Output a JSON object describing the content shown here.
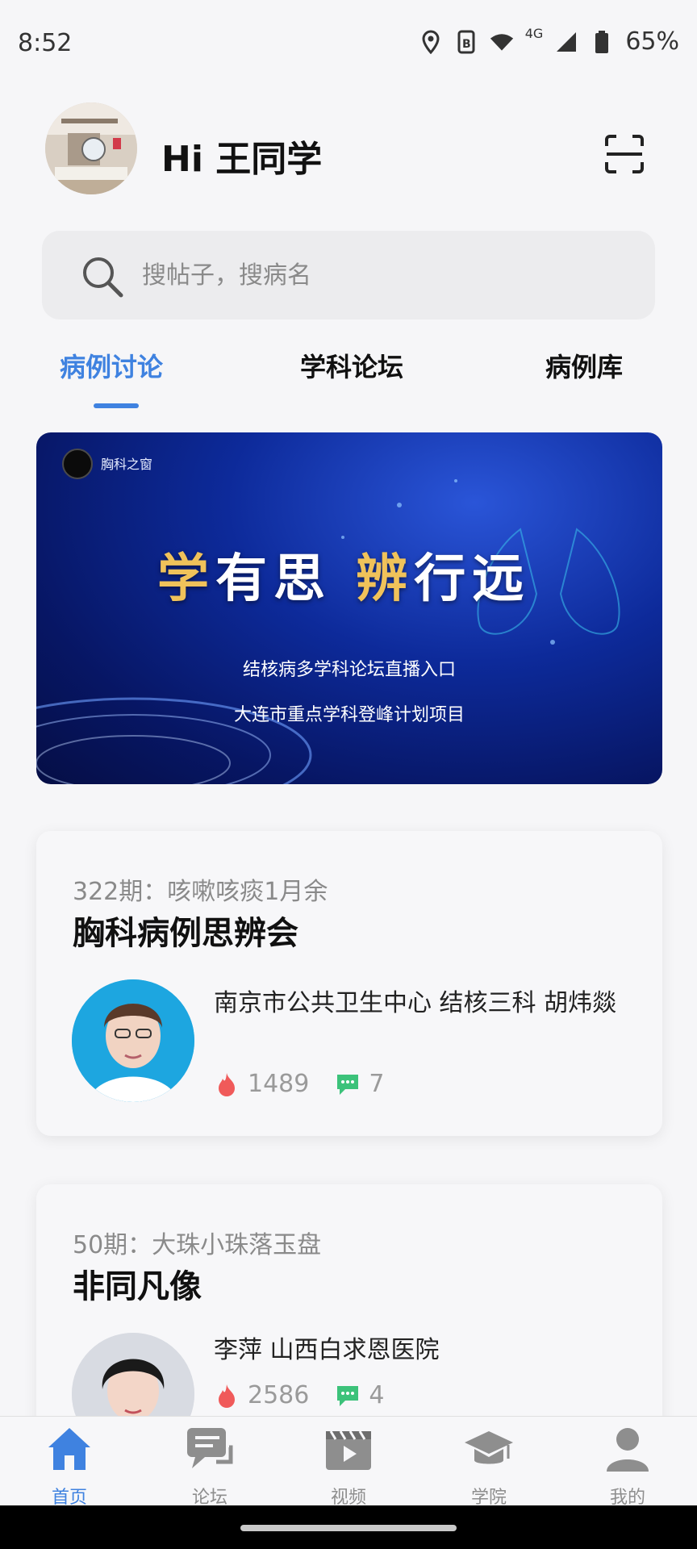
{
  "status_bar": {
    "time": "8:52",
    "network": "4G",
    "battery": "65%"
  },
  "header": {
    "greeting": "Hi 王同学"
  },
  "search": {
    "placeholder": "搜帖子，搜病名"
  },
  "tabs": [
    {
      "label": "病例讨论",
      "active": true
    },
    {
      "label": "学科论坛",
      "active": false
    },
    {
      "label": "病例库",
      "active": false
    }
  ],
  "banner": {
    "brand": "胸科之窗",
    "title_part1": "学",
    "title_part2": "有思 ",
    "title_part3": "辨",
    "title_part4": "行远",
    "line1": "结核病多学科论坛直播入口",
    "line2": "大连市重点学科登峰计划项目"
  },
  "cards": [
    {
      "issue": "322期：咳嗽咳痰1月余",
      "title": "胸科病例思辨会",
      "doctor": "南京市公共卫生中心 结核三科 胡炜燚",
      "views": "1489",
      "comments": "7"
    },
    {
      "issue": "50期：大珠小珠落玉盘",
      "title": "非同凡像",
      "doctor": "李萍 山西白求恩医院",
      "views": "2586",
      "comments": "4"
    }
  ],
  "bottom_nav": [
    {
      "label": "首页",
      "icon": "home-icon",
      "active": true
    },
    {
      "label": "论坛",
      "icon": "forum-icon",
      "active": false
    },
    {
      "label": "视频",
      "icon": "video-icon",
      "active": false
    },
    {
      "label": "学院",
      "icon": "academy-icon",
      "active": false
    },
    {
      "label": "我的",
      "icon": "profile-icon",
      "active": false
    }
  ],
  "colors": {
    "accent": "#3f82e0",
    "banner_gold": "#f0c25a",
    "fire": "#f05a5a",
    "comment": "#3cc27a"
  }
}
